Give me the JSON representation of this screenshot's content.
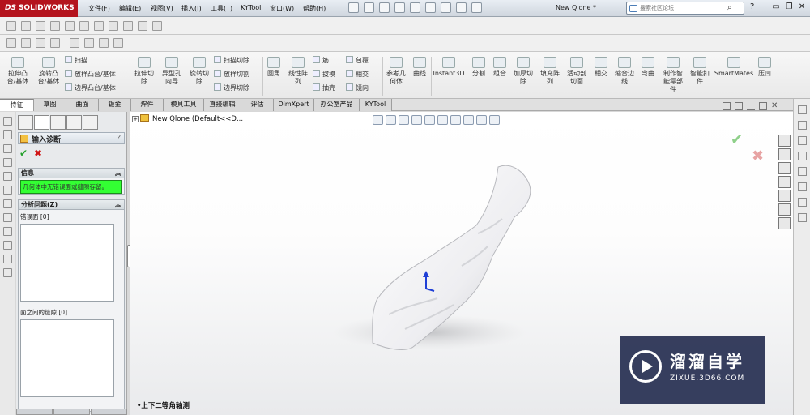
{
  "app": {
    "logo_text": "SOLIDWORKS",
    "logo_prefix": "DS",
    "document_title": "New Qlone *"
  },
  "menu": [
    {
      "label": "文件(F)"
    },
    {
      "label": "编辑(E)"
    },
    {
      "label": "视图(V)"
    },
    {
      "label": "插入(I)"
    },
    {
      "label": "工具(T)"
    },
    {
      "label": "KYTool"
    },
    {
      "label": "窗口(W)"
    },
    {
      "label": "帮助(H)"
    }
  ],
  "search": {
    "placeholder": "搜索社区论坛"
  },
  "window_controls": {
    "minimize": "▭",
    "restore": "❐",
    "close": "✕",
    "help": "?"
  },
  "command_manager": {
    "features": [
      {
        "label": "拉伸凸\n台/基体"
      },
      {
        "label": "旋转凸\n台/基体"
      },
      {
        "label": "拉伸切\n除"
      },
      {
        "label": "异型孔\n向导"
      },
      {
        "label": "旋转切\n除"
      },
      {
        "label": "圆角"
      },
      {
        "label": "线性阵\n列"
      },
      {
        "label": "参考几\n何体"
      },
      {
        "label": "曲线"
      },
      {
        "label": "Instant3D"
      },
      {
        "label": "分割"
      },
      {
        "label": "组合"
      },
      {
        "label": "加厚切\n除"
      },
      {
        "label": "填充阵\n列"
      },
      {
        "label": "活动剖\n切面"
      },
      {
        "label": "相交"
      },
      {
        "label": "缩合边\n线"
      },
      {
        "label": "弯曲"
      },
      {
        "label": "制作智\n能零部\n件"
      },
      {
        "label": "智能扣\n件"
      },
      {
        "label": "SmartMates"
      },
      {
        "label": "压凹"
      }
    ],
    "small_items": [
      {
        "label": "扫描"
      },
      {
        "label": "放样凸台/基体"
      },
      {
        "label": "边界凸台/基体"
      },
      {
        "label": "扫描切除"
      },
      {
        "label": "放样切割"
      },
      {
        "label": "边界切除"
      },
      {
        "label": "筋"
      },
      {
        "label": "拔模"
      },
      {
        "label": "抽壳"
      },
      {
        "label": "包覆"
      },
      {
        "label": "相交"
      },
      {
        "label": "镜向"
      }
    ]
  },
  "tabs": [
    {
      "label": "特征",
      "active": true
    },
    {
      "label": "草图"
    },
    {
      "label": "曲面"
    },
    {
      "label": "钣金"
    },
    {
      "label": "焊件"
    },
    {
      "label": "模具工具"
    },
    {
      "label": "直接编辑"
    },
    {
      "label": "评估"
    },
    {
      "label": "DimXpert"
    },
    {
      "label": "办公室产品"
    },
    {
      "label": "KYTool"
    }
  ],
  "property_manager": {
    "title": "输入诊断",
    "help": "?",
    "ok": "✔",
    "cancel": "✖",
    "info_section": {
      "title": "信息",
      "message": "几何体中无错误面或缝隙存留。"
    },
    "analysis_section": {
      "title": "分析问题(Z)",
      "faulty_faces_label": "错误面 [0]",
      "gaps_label": "面之间的缝隙 [0]"
    }
  },
  "viewport": {
    "tree_root": "New Qlone  (Default<<D...",
    "view_orientation": "•上下二等角轴测",
    "confirm_ok": "✔",
    "confirm_cancel": "✖",
    "colors": {
      "model": "#f2f2f4",
      "triad_blue": "#1f3fd6"
    }
  },
  "watermark": {
    "title": "溜溜自学",
    "url": "ZIXUE.3D66.COM"
  }
}
